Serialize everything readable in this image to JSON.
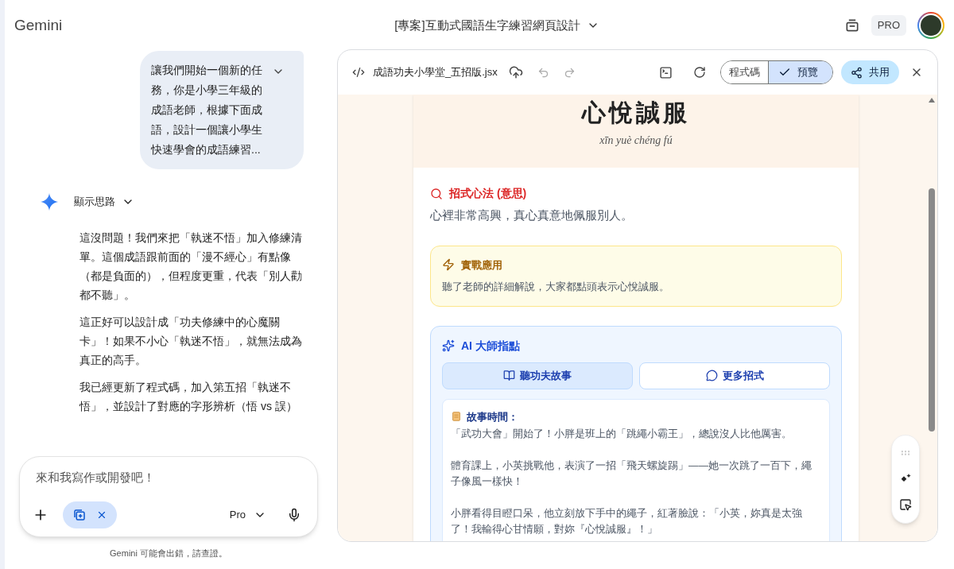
{
  "app": {
    "name": "Gemini",
    "title": "[專案]互動式國語生字練習網頁設計",
    "plan_badge": "PRO"
  },
  "chat": {
    "user_message": "讓我們開始一個新的任務，你是小學三年級的成語老師，根據下面成語，設計一個讓小學生快速學會的成語練習...",
    "thinking_toggle": "顯示思路",
    "paragraphs": [
      "這沒問題！我們來把「執迷不悟」加入修練清單。這個成語跟前面的「漫不經心」有點像（都是負面的），但程度更重，代表「別人勸都不聽」。",
      "這正好可以設計成「功夫修練中的心魔關卡」！如果不小心「執迷不悟」，就無法成為真正的高手。",
      "我已經更新了程式碼，加入第五招「執迷不悟」，並設計了對應的字形辨析（悟 vs 誤）"
    ],
    "input": {
      "placeholder": "來和我寫作或開發吧！",
      "model": "Pro"
    },
    "disclaimer": "Gemini 可能會出錯，請查證。"
  },
  "canvas": {
    "file_name": "成語功夫小學堂_五招版.jsx",
    "view_tabs": [
      {
        "label": "程式碼",
        "selected": false
      },
      {
        "label": "預覽",
        "selected": true
      }
    ],
    "share": "共用",
    "preview": {
      "idiom": "心悅誠服",
      "pinyin": "xīn yuè chéng fú",
      "meaning_heading": "招式心法 (意思)",
      "meaning": "心裡非常高興，真心真意地佩服別人。",
      "example_heading": "實戰應用",
      "example": "聽了老師的詳細解說，大家都點頭表示心悅誠服。",
      "ai_heading": "AI 大師指點",
      "ai_tabs": [
        {
          "label": "聽功夫故事",
          "selected": true
        },
        {
          "label": "更多招式",
          "selected": false
        }
      ],
      "story_heading": "故事時間：",
      "story": [
        "「武功大會」開始了！小胖是班上的「跳繩小霸王」，總說沒人比他厲害。",
        "體育課上，小英挑戰他，表演了一招「飛天螺旋踢」——她一次跳了一百下，繩子像風一樣快！",
        "小胖看得目瞪口呆，他立刻放下手中的繩子，紅著臉說：「小英，妳真是太強了！我輸得心甘情願，對妳『心悅誠服』！」"
      ]
    }
  }
}
